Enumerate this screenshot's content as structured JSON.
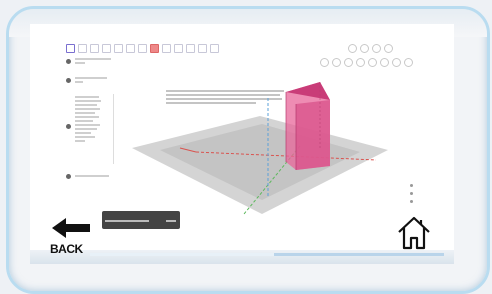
{
  "navigation": {
    "back_label": "BACK"
  },
  "back_button": {
    "icon": "arrow-left-icon"
  },
  "home_button": {
    "icon": "home-icon"
  },
  "video_progress": {
    "fraction": 0.52
  },
  "colors": {
    "frame_border": "#b9dcf0",
    "prism_fill": "#e8669a",
    "axis_red": "#d9534f",
    "axis_green": "#5cb85c",
    "axis_blue": "#337ab7",
    "tooltip_bg": "#444444"
  }
}
